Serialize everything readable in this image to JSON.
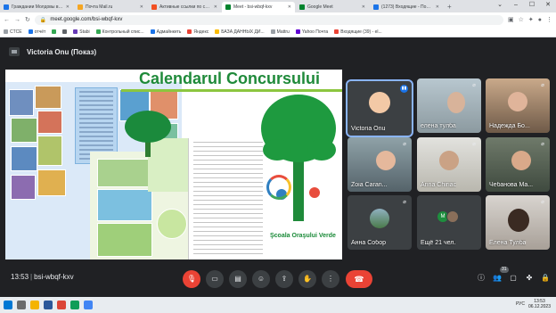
{
  "browser": {
    "tabs": [
      {
        "title": "Граждании Молдовы во...",
        "color": "#1a73e8"
      },
      {
        "title": "Почта Mail.ru",
        "color": "#f5a623"
      },
      {
        "title": "Активные ссылки по сос...",
        "color": "#f25022"
      },
      {
        "title": "Meet - bsi-wbqf-kxv",
        "color": "#00832d",
        "active": true
      },
      {
        "title": "Google Meet",
        "color": "#00832d"
      },
      {
        "title": "(1273) Входящие - Почта...",
        "color": "#1a73e8"
      }
    ],
    "new_tab": "+",
    "url": "meet.google.com/bsi-wbqf-kxv",
    "bookmarks": [
      "CTCE",
      "отчёт",
      "",
      "",
      "Stabi",
      "Контрольный спис...",
      "Адмайнкеть",
      "Яндекс",
      "БАЗА ДАННЫХ ДИ...",
      "Mattru",
      "Yahoo Почта",
      "Входящие (39) - el..."
    ]
  },
  "meet": {
    "presenter": "Victoria Onu (Показ)",
    "slide": {
      "title": "Calendarul Concursului",
      "school": "Şcoala Oraşului Verde"
    },
    "participants": [
      {
        "name": "Victoria Onu",
        "speaking": true
      },
      {
        "name": "елена тулба"
      },
      {
        "name": "Надежда Бо..."
      },
      {
        "name": "Zoia Caran..."
      },
      {
        "name": "Anna Chiriac"
      },
      {
        "name": "Чебанова Ма..."
      },
      {
        "name": "Анна Собор"
      },
      {
        "name": "Ещё 21 чел."
      },
      {
        "name": "Елена Тулба"
      }
    ],
    "more_initial": "M",
    "time": "13:53",
    "meeting_code": "bsi-wbqf-kxv",
    "people_count": "31"
  },
  "taskbar": {
    "lang": "РУС",
    "time": "13:53",
    "date": "06.12.2023"
  }
}
